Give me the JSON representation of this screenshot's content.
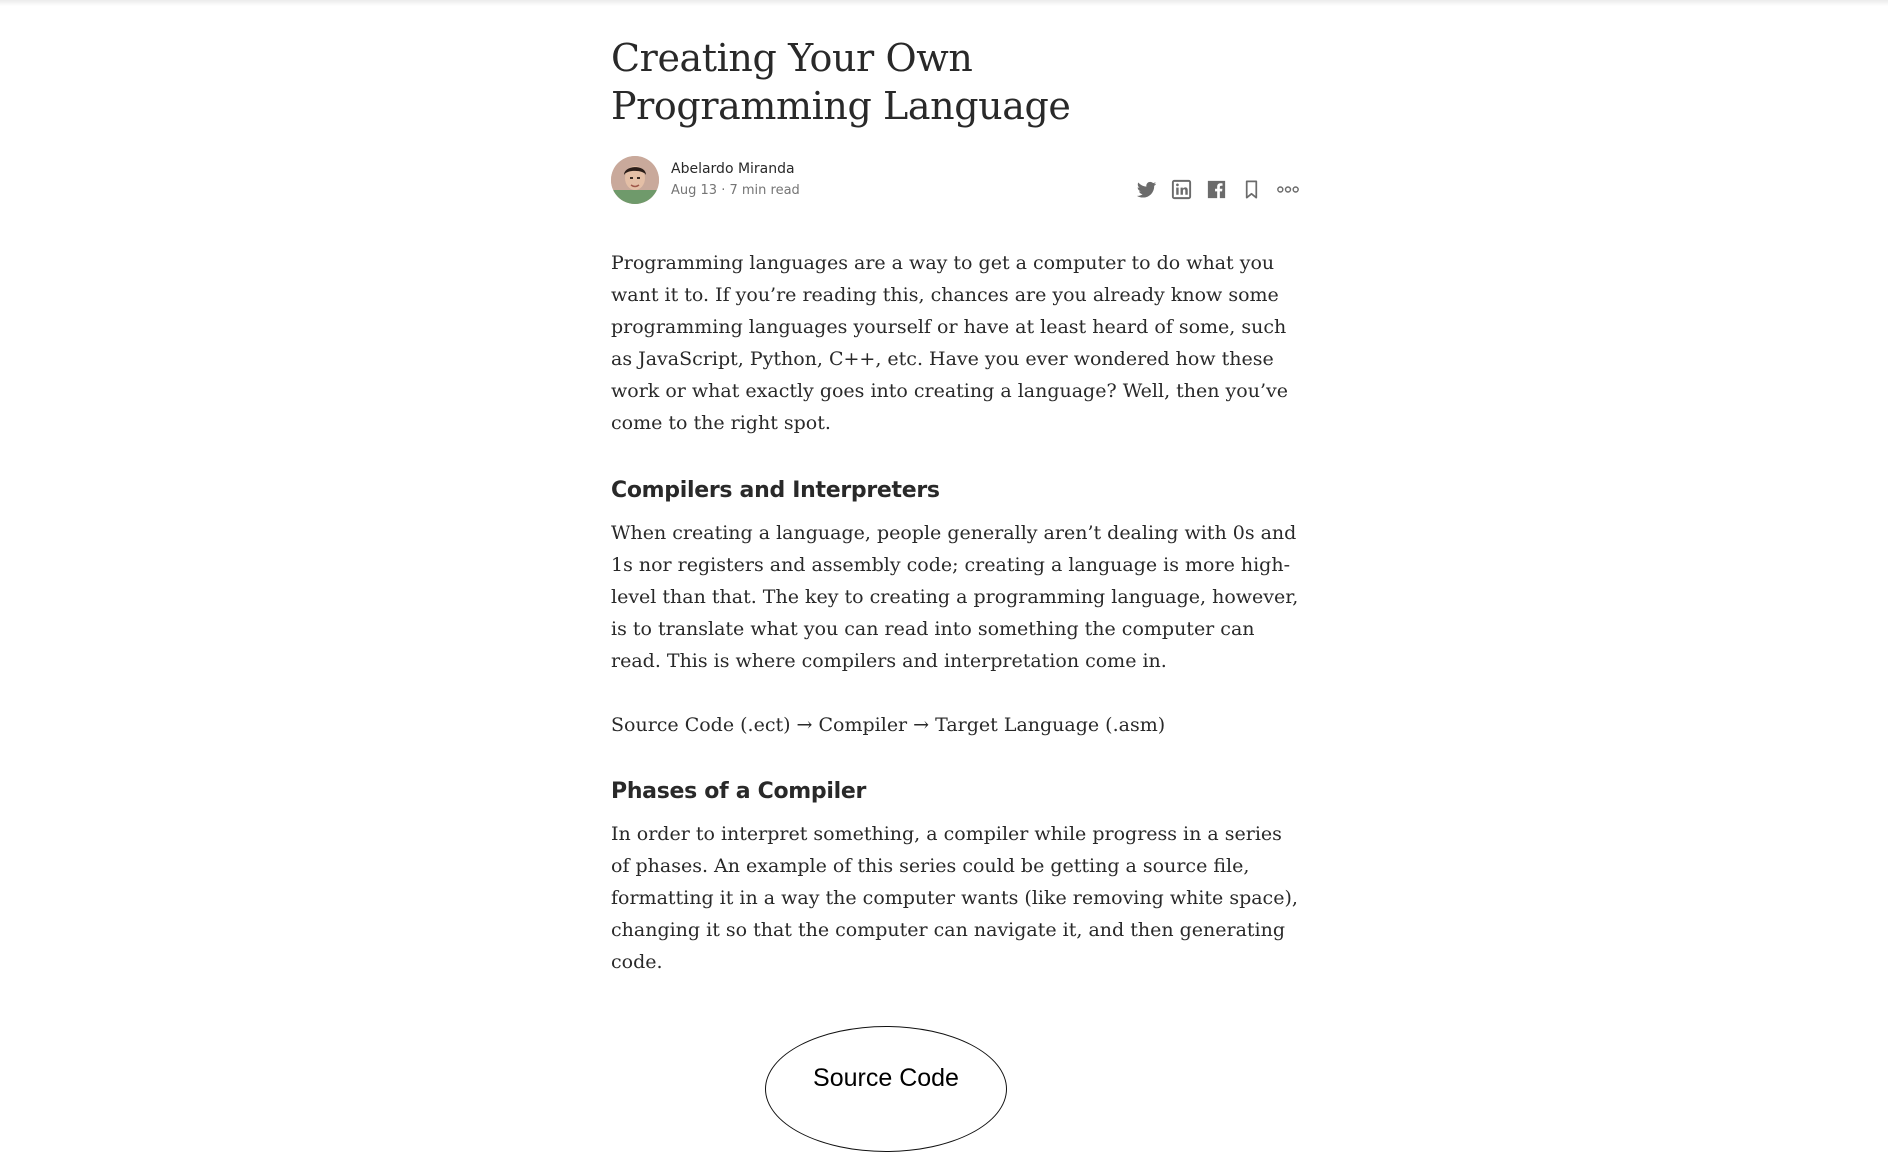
{
  "article": {
    "title": "Creating Your Own Programming Language",
    "author": "Abelardo Miranda",
    "meta": "Aug 13 · 7 min read",
    "paragraphs": {
      "p1": "Programming languages are a way to get a computer to do what you want it to. If you’re reading this, chances are you already know some programming languages yourself or have at least heard of some, such as JavaScript, Python, C++, etc. Have you ever wondered how these work or what exactly goes into creating a language? Well, then you’ve come to the right spot.",
      "p2": "When creating a language, people generally aren’t dealing with 0s and 1s nor registers and assembly code; creating a language is more high-level than that. The key to creating a programming language, however, is to translate what you can read into something the computer can read. This is where compilers and interpretation come in.",
      "p3": "Source Code (.ect) → Compiler → Target Language (.asm)",
      "p4": "In order to interpret something, a compiler while progress in a series of phases. An example of this series could be getting a source file, formatting it in a way the computer wants (like removing white space), changing it so that the computer can navigate it, and then generating code."
    },
    "headings": {
      "h1": "Compilers and Interpreters",
      "h2": "Phases of a Compiler"
    },
    "diagram": {
      "node1": "Source Code"
    }
  },
  "share_icons": [
    "twitter-icon",
    "linkedin-icon",
    "facebook-icon",
    "bookmark-icon",
    "more-icon"
  ],
  "colors": {
    "text": "#292929",
    "meta": "#757575",
    "icon": "#6b6b6b"
  }
}
